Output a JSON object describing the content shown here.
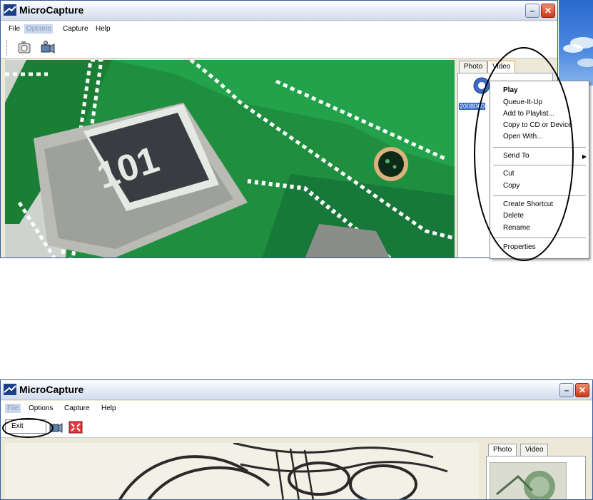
{
  "window1": {
    "title": "MicroCapture",
    "menu": [
      "File",
      "Options",
      "Capture",
      "Help"
    ],
    "active_menu": "Options",
    "minimize_glyph": "–",
    "close_glyph": "✕",
    "toolbar_icons": [
      "snapshot-icon",
      "record-video-icon"
    ],
    "tabs": [
      "Photo",
      "Video"
    ],
    "selected_tab": "Video",
    "file_label": "20080€0",
    "viewport_caption": "101",
    "context_menu": {
      "items": [
        {
          "label": "Play",
          "bold": true
        },
        {
          "label": "Queue-It-Up"
        },
        {
          "label": "Add to Playlist..."
        },
        {
          "label": "Copy to CD or Device"
        },
        {
          "label": "Open With..."
        },
        {
          "label": "Send To",
          "submenu": true
        },
        {
          "label": "Cut"
        },
        {
          "label": "Copy"
        },
        {
          "label": "Create Shortcut"
        },
        {
          "label": "Delete"
        },
        {
          "label": "Rename"
        },
        {
          "label": "Properties"
        }
      ],
      "submenu_glyph": "▶"
    }
  },
  "window2": {
    "title": "MicroCapture",
    "menu": [
      "File",
      "Options",
      "Capture",
      "Help"
    ],
    "active_menu": "File",
    "minimize_glyph": "–",
    "close_glyph": "✕",
    "exit_label": "Exit",
    "toolbar_icons": [
      "capture-icon",
      "fullscreen-icon"
    ],
    "tabs": [
      "Photo",
      "Video"
    ],
    "selected_tab": "Photo"
  },
  "colors": {
    "selection": "#316ac5",
    "pcb_green": "#1a8a3a",
    "title_close": "#c93a1a"
  }
}
